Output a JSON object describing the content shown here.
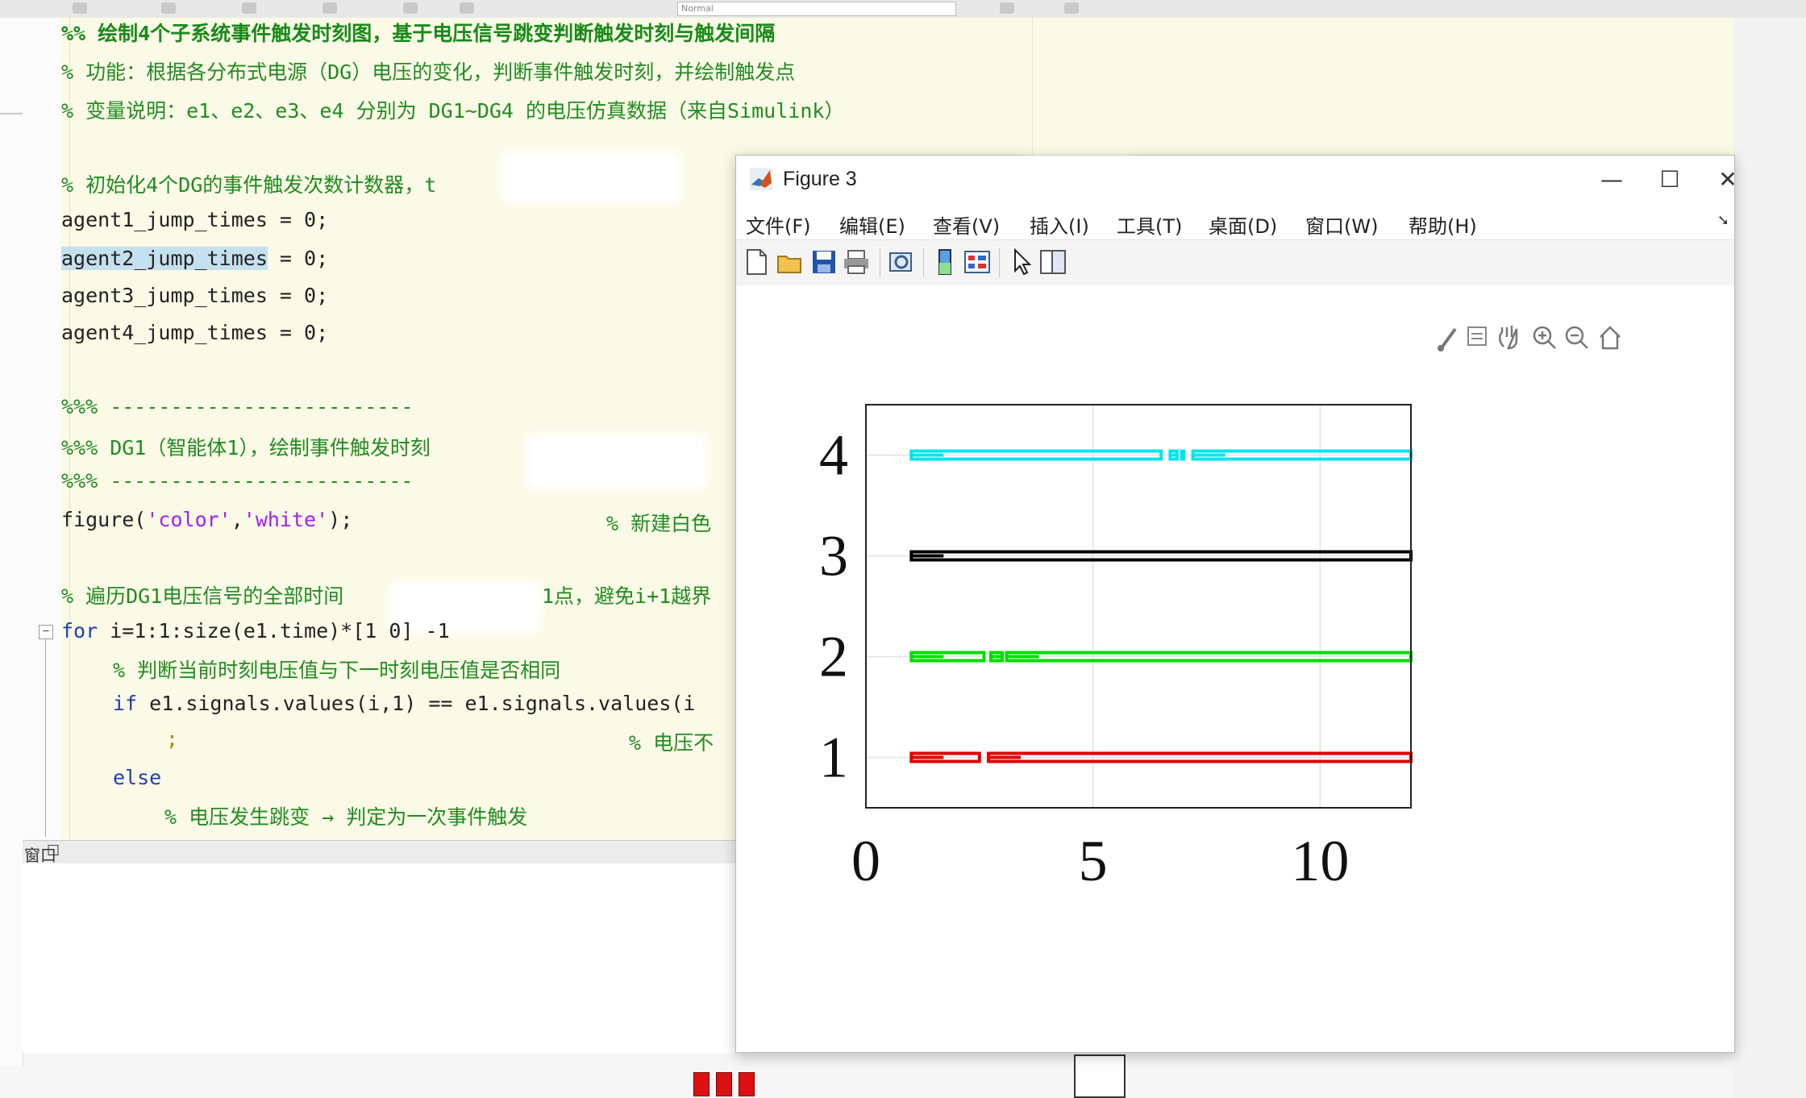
{
  "editor": {
    "lines": [
      {
        "type": "header",
        "text": "%% 绘制4个子系统事件触发时刻图，基于电压信号跳变判断触发时刻与触发间隔"
      },
      {
        "type": "comment",
        "text": "% 功能：根据各分布式电源（DG）电压的变化，判断事件触发时刻，并绘制触发点"
      },
      {
        "type": "comment",
        "text": "% 变量说明：e1、e2、e3、e4 分别为 DG1~DG4 的电压仿真数据（来自Simulink）"
      },
      {
        "type": "comment",
        "text": "% 初始化4个DG的事件触发次数计数器，t"
      },
      {
        "type": "code",
        "text": "agent1_jump_times = 0;"
      },
      {
        "type": "code_hl",
        "hl": "agent2_jump_times",
        "text": " = 0;"
      },
      {
        "type": "code",
        "text": "agent3_jump_times = 0;"
      },
      {
        "type": "code",
        "text": "agent4_jump_times = 0;"
      },
      {
        "type": "comment",
        "text": "%%% -------------------------"
      },
      {
        "type": "comment",
        "text": "%%% DG1（智能体1），绘制事件触发时刻"
      },
      {
        "type": "comment",
        "text": "%%% -------------------------"
      },
      {
        "type": "figure_line",
        "fn": "figure(",
        "s1": "'color'",
        "comma": ",",
        "s2": "'white'",
        "end": ");",
        "trail": "% 新建白色"
      },
      {
        "type": "comment",
        "text": "% 遍历DG1电压信号的全部时间",
        "trail": "1点，避免i+1越界"
      },
      {
        "type": "for",
        "kw": "for",
        "text": " i=1:1:size(e1.time)*[1 0] -1"
      },
      {
        "type": "comment_indent",
        "text": "% 判断当前时刻电压值与下一时刻电压值是否相同"
      },
      {
        "type": "if",
        "kw": "if",
        "text": " e1.signals.values(i,1) == e1.signals.values(i"
      },
      {
        "type": "mixed",
        "text": ";",
        "trail": "% 电压不"
      },
      {
        "type": "else",
        "kw": "else"
      },
      {
        "type": "comment_indent2",
        "text": "% 电压发生跳变 → 判定为一次事件触发"
      }
    ],
    "cmd_label": "窗口"
  },
  "toolbar_combo": "Normal",
  "figure": {
    "title": "Figure 3",
    "menu": [
      "文件(F)",
      "编辑(E)",
      "查看(V)",
      "插入(I)",
      "工具(T)",
      "桌面(D)",
      "窗口(W)",
      "帮助(H)"
    ],
    "toolbar_icons": [
      "new-file-icon",
      "open-folder-icon",
      "save-icon",
      "print-icon",
      "link-figure-icon",
      "colorbar-icon",
      "legend-icon",
      "pointer-icon",
      "property-editor-icon"
    ],
    "axes_toolbar_icons": [
      "brush-icon",
      "data-tip-icon",
      "pan-icon",
      "zoom-in-icon",
      "zoom-out-icon",
      "home-icon"
    ]
  },
  "chart_data": {
    "type": "scatter",
    "title": "",
    "xlabel": "",
    "ylabel": "",
    "xlim": [
      0,
      12
    ],
    "ylim": [
      0.5,
      4.5
    ],
    "xticks": [
      0,
      5,
      10
    ],
    "yticks": [
      1,
      2,
      3,
      4
    ],
    "grid": true,
    "series": [
      {
        "y": 1,
        "color": "#e00000",
        "segments": [
          [
            1.0,
            2.5
          ],
          [
            2.7,
            12.0
          ]
        ]
      },
      {
        "y": 2,
        "color": "#00dd00",
        "segments": [
          [
            1.0,
            2.6
          ],
          [
            2.75,
            3.0
          ],
          [
            3.1,
            12.0
          ]
        ]
      },
      {
        "y": 3,
        "color": "#000000",
        "segments": [
          [
            1.0,
            12.0
          ]
        ]
      },
      {
        "y": 4,
        "color": "#00e5ee",
        "segments": [
          [
            1.0,
            6.5
          ],
          [
            6.7,
            6.85
          ],
          [
            6.95,
            7.0
          ],
          [
            7.2,
            12.0
          ]
        ]
      }
    ]
  }
}
